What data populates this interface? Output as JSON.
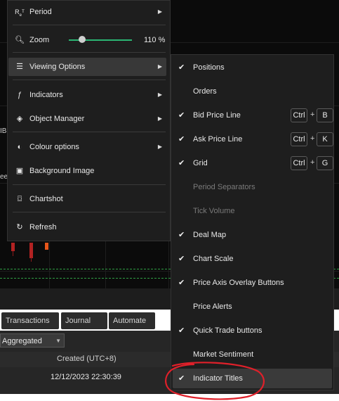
{
  "main_menu": {
    "period": {
      "icon": "period-icon",
      "label": "Period"
    },
    "zoom": {
      "icon": "zoom-icon",
      "label": "Zoom",
      "value_text": "110 %",
      "level_percent": 110
    },
    "viewing_options": {
      "icon": "viewing-options-icon",
      "label": "Viewing Options"
    },
    "indicators": {
      "icon": "indicators-icon",
      "label": "Indicators"
    },
    "object_manager": {
      "icon": "object-manager-icon",
      "label": "Object Manager"
    },
    "colour_options": {
      "icon": "palette-icon",
      "label": "Colour options"
    },
    "background_image": {
      "icon": "image-icon",
      "label": "Background Image"
    },
    "chartshot": {
      "icon": "camera-icon",
      "label": "Chartshot"
    },
    "refresh": {
      "icon": "refresh-icon",
      "label": "Refresh"
    }
  },
  "submenu": {
    "items": [
      {
        "label": "Positions",
        "checked": true,
        "enabled": true
      },
      {
        "label": "Orders",
        "checked": false,
        "enabled": true
      },
      {
        "label": "Bid Price Line",
        "checked": true,
        "enabled": true,
        "shortcut": [
          "Ctrl",
          "+",
          "B"
        ]
      },
      {
        "label": "Ask Price Line",
        "checked": true,
        "enabled": true,
        "shortcut": [
          "Ctrl",
          "+",
          "K"
        ]
      },
      {
        "label": "Grid",
        "checked": true,
        "enabled": true,
        "shortcut": [
          "Ctrl",
          "+",
          "G"
        ]
      },
      {
        "label": "Period Separators",
        "checked": false,
        "enabled": false
      },
      {
        "label": "Tick Volume",
        "checked": false,
        "enabled": false
      },
      {
        "label": "Deal Map",
        "checked": true,
        "enabled": true
      },
      {
        "label": "Chart Scale",
        "checked": true,
        "enabled": true
      },
      {
        "label": "Price Axis Overlay Buttons",
        "checked": true,
        "enabled": true
      },
      {
        "label": "Price Alerts",
        "checked": false,
        "enabled": true
      },
      {
        "label": "Quick Trade buttons",
        "checked": true,
        "enabled": true
      },
      {
        "label": "Market Sentiment",
        "checked": false,
        "enabled": true
      },
      {
        "label": "Indicator Titles",
        "checked": true,
        "enabled": true
      }
    ]
  },
  "bottom_tabs": {
    "transactions": "Transactions",
    "journal": "Journal",
    "automate": "Automate"
  },
  "panel": {
    "filter_value": "Aggregated",
    "column_created": "Created (UTC+8)",
    "row_created": "12/12/2023 22:30:39"
  },
  "edge_fragments": {
    "left_1": "IBi",
    "left_2": "ee"
  },
  "colors": {
    "accent_green": "#2bb673",
    "annotation_red": "#e0202a",
    "candle_red": "#b22222",
    "candle_orange": "#e8561a"
  }
}
